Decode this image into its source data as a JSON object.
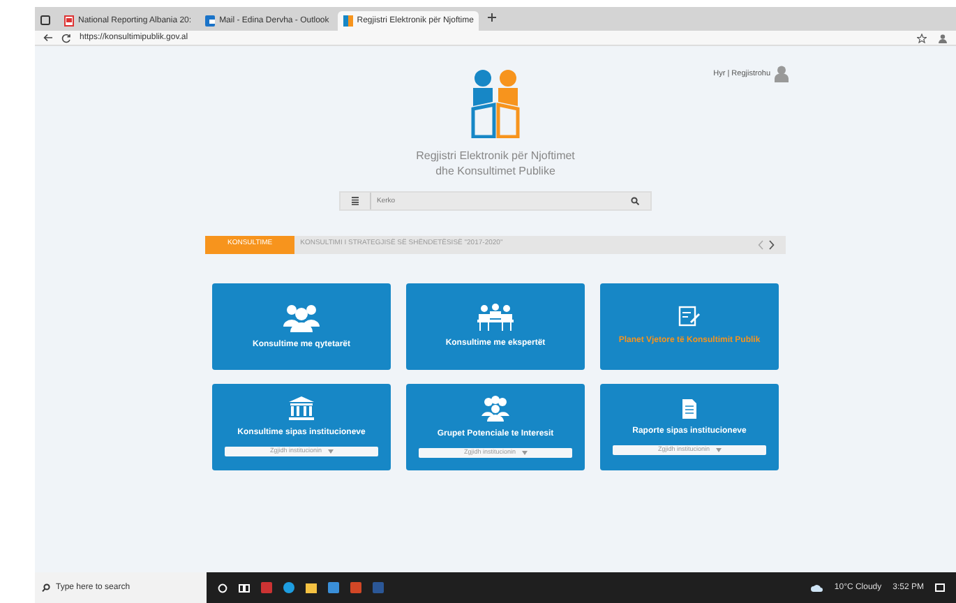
{
  "browser": {
    "tabs": [
      {
        "title": "National Reporting Albania 20:",
        "selected": false,
        "kind": "pdf"
      },
      {
        "title": "Mail - Edina Dervha - Outlook",
        "selected": false,
        "kind": "mail"
      },
      {
        "title": "Regjistri Elektronik për Njoftime",
        "selected": true,
        "kind": "site"
      }
    ],
    "url": "https://konsultimipublik.gov.al"
  },
  "header": {
    "login": "Hyr | Regjistrohu"
  },
  "logo": {
    "title_line_1": "Regjistri Elektronik për Njoftimet",
    "title_line_2": "dhe Konsultimet Publike"
  },
  "search": {
    "placeholder": "Kerko"
  },
  "ticker": {
    "label": "KONSULTIME",
    "text": "KONSULTIMI I STRATEGJISË SË SHËNDETËSISË \"2017-2020\""
  },
  "tiles": [
    {
      "title": "Konsultime me qytetarët",
      "kind": "people",
      "highlight": false
    },
    {
      "title": "Konsultime me ekspertët",
      "kind": "meeting",
      "highlight": false
    },
    {
      "title": "Planet Vjetore të Konsultimit Publik",
      "kind": "plan",
      "highlight": true
    },
    {
      "title": "Konsultime sipas institucioneve",
      "kind": "building",
      "highlight": false,
      "dropdown": "Zgjidh institucionin"
    },
    {
      "title": "Grupet Potenciale te Interesit",
      "kind": "group",
      "highlight": false,
      "dropdown": "Zgjidh institucionin"
    },
    {
      "title": "Raporte sipas institucioneve",
      "kind": "document",
      "highlight": false,
      "dropdown": "Zgjidh institucionin"
    }
  ],
  "taskbar": {
    "search_placeholder": "Type here to search",
    "weather": "10°C Cloudy",
    "time": "3:52 PM"
  }
}
